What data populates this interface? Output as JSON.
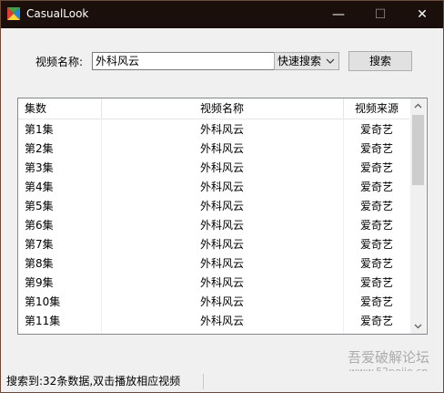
{
  "window": {
    "title": "CasualLook",
    "min_glyph": "—",
    "max_glyph": "☐",
    "close_glyph": "✕"
  },
  "search": {
    "label": "视频名称:",
    "value": "外科风云",
    "mode_selected": "快速搜索",
    "button_label": "搜索"
  },
  "table": {
    "columns": [
      "集数",
      "视频名称",
      "视频来源"
    ],
    "rows": [
      {
        "episode": "第1集",
        "name": "外科风云",
        "source": "爱奇艺"
      },
      {
        "episode": "第2集",
        "name": "外科风云",
        "source": "爱奇艺"
      },
      {
        "episode": "第3集",
        "name": "外科风云",
        "source": "爱奇艺"
      },
      {
        "episode": "第4集",
        "name": "外科风云",
        "source": "爱奇艺"
      },
      {
        "episode": "第5集",
        "name": "外科风云",
        "source": "爱奇艺"
      },
      {
        "episode": "第6集",
        "name": "外科风云",
        "source": "爱奇艺"
      },
      {
        "episode": "第7集",
        "name": "外科风云",
        "source": "爱奇艺"
      },
      {
        "episode": "第8集",
        "name": "外科风云",
        "source": "爱奇艺"
      },
      {
        "episode": "第9集",
        "name": "外科风云",
        "source": "爱奇艺"
      },
      {
        "episode": "第10集",
        "name": "外科风云",
        "source": "爱奇艺"
      },
      {
        "episode": "第11集",
        "name": "外科风云",
        "source": "爱奇艺"
      }
    ]
  },
  "status": {
    "text": "搜索到:32条数据,双击播放相应视频"
  },
  "watermark": {
    "line1": "吾爱破解论坛",
    "line2": "www.52pojie.cn"
  },
  "icons": {
    "app": "app-logo-icon",
    "scroll_up": "chevron-up-icon",
    "scroll_down": "chevron-down-icon",
    "dropdown": "chevron-down-icon"
  },
  "colors": {
    "titlebar": "#1a0f0b",
    "window_bg": "#f0f0f0",
    "list_bg": "#ffffff"
  }
}
